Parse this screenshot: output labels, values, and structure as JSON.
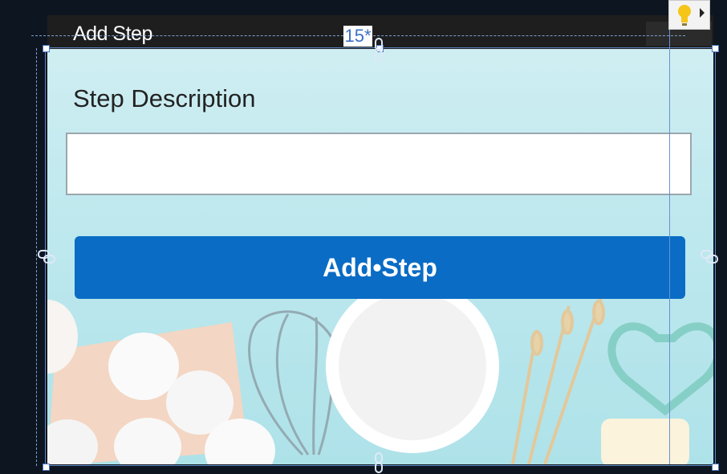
{
  "window": {
    "title": "Add Step"
  },
  "form": {
    "step_label": "Step Description",
    "step_value": "",
    "add_button_label": "Add•Step"
  },
  "designer": {
    "grid_label": "15*"
  },
  "colors": {
    "button": "#0a6cc5",
    "content_bg": "#bde8ee",
    "designer_bg": "#0d1520",
    "adorner": "#6a90d0"
  },
  "icons": [
    "lightbulb-icon",
    "play-arrow-icon",
    "link-icon"
  ]
}
